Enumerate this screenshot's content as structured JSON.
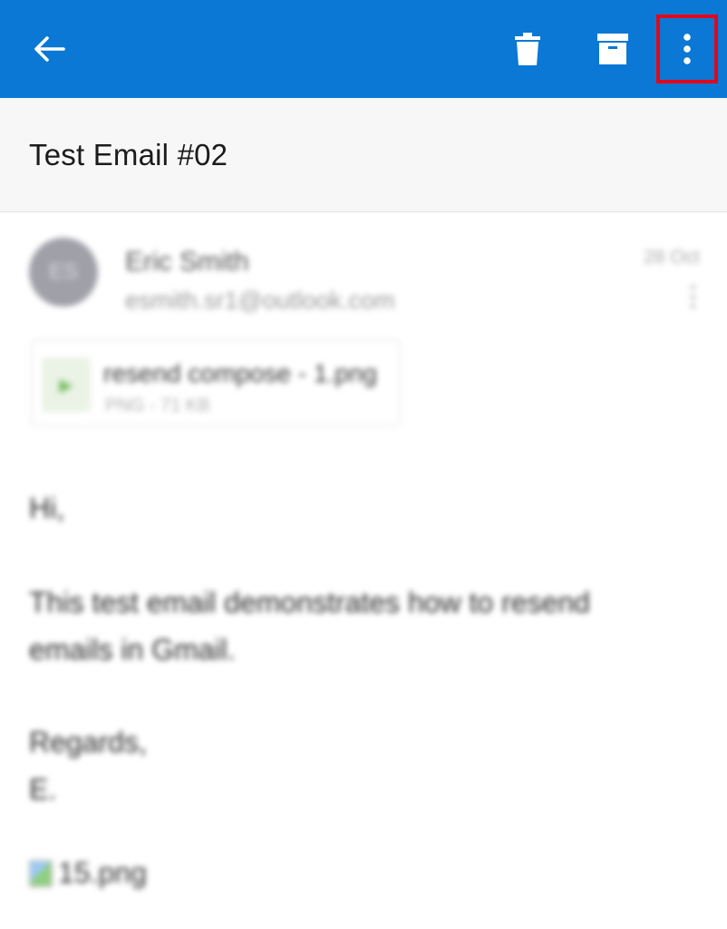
{
  "appbar": {
    "color": "#0a78d4",
    "back_icon": "arrow-left-icon",
    "delete_icon": "trash-icon",
    "archive_icon": "archive-icon",
    "more_icon": "more-vertical-icon",
    "highlight_color": "#e3061a"
  },
  "subject": "Test Email #02",
  "message": {
    "avatar_initials": "ES",
    "sender_name": "Eric Smith",
    "sender_email": "esmith.sr1@outlook.com",
    "date": "28 Oct",
    "attachment": {
      "name": "resend compose - 1.png",
      "meta": "PNG - 71 KB"
    },
    "body": {
      "greeting": "Hi,",
      "paragraph": "This test email demonstrates how to resend emails in Gmail.",
      "sign_off": "Regards,",
      "signature": "E.",
      "inline_image_label": "15.png"
    }
  }
}
